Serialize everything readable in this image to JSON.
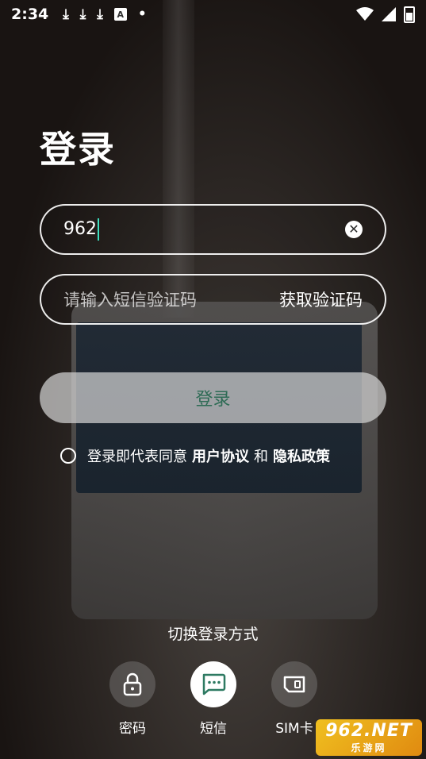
{
  "status_bar": {
    "time": "2:34",
    "icons": [
      "download-icon",
      "download-icon",
      "download-icon",
      "text-a-icon",
      "dot-icon"
    ],
    "right_icons": [
      "wifi-icon",
      "signal-icon",
      "battery-icon"
    ]
  },
  "title": "登录",
  "phone_field": {
    "value": "962",
    "clear_icon": "clear-icon"
  },
  "code_field": {
    "placeholder": "请输入短信验证码",
    "action_label": "获取验证码"
  },
  "login_button": {
    "label": "登录"
  },
  "agreement": {
    "prefix": "登录即代表同意",
    "user_agreement": "用户协议",
    "and": "和",
    "privacy_policy": "隐私政策"
  },
  "switch_method": {
    "label": "切换登录方式",
    "methods": [
      {
        "label": "密码",
        "icon": "lock-icon",
        "active": false
      },
      {
        "label": "短信",
        "icon": "message-icon",
        "active": true
      },
      {
        "label": "SIM卡",
        "icon": "sim-card-icon",
        "active": false
      }
    ]
  },
  "watermark": {
    "top": "962.NET",
    "bottom": "乐游网"
  }
}
